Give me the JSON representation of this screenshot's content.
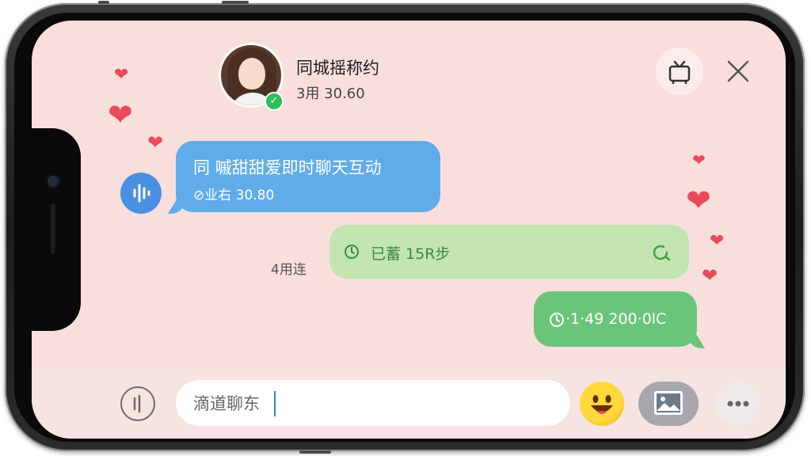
{
  "contact": {
    "name": "同城摇称约",
    "status": "3用  30.60"
  },
  "messages": [
    {
      "text": "同 嘁甜甜爱即时聊天互动",
      "meta": "⊘业右  30.80",
      "style": "incoming-blue"
    },
    {
      "text": "已蓄  15R步",
      "style": "outgoing-light-green"
    },
    {
      "text": "·1·49  200·0lC",
      "style": "outgoing-green"
    }
  ],
  "side_label": "4用连",
  "input": {
    "value": "滴道聊东"
  },
  "icons": {
    "voice_message": "voice-wave-icon",
    "emoji": "emoji-face-icon",
    "image": "image-icon",
    "more": "more-icon",
    "sticker": "tv-sticker-icon",
    "close": "close-icon",
    "mic": "voice-input-icon",
    "verified": "check-badge-icon",
    "decor": "heart-icon"
  },
  "colors": {
    "background": "#f9dfdc",
    "incoming_bubble": "#60ace9",
    "outgoing_light": "#c3e5b1",
    "outgoing_dark": "#6ac57b",
    "heart": "#ea4a5a",
    "verified": "#2ebd59"
  }
}
